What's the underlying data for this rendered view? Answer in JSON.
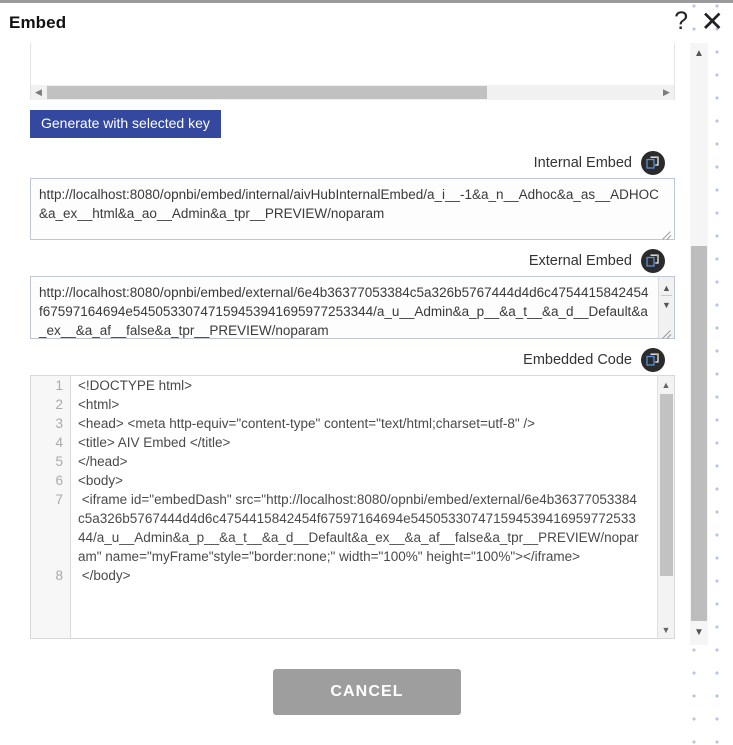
{
  "dialog": {
    "title": "Embed",
    "help_icon": "?",
    "close_icon": "✕"
  },
  "toolbar": {
    "generate_label": "Generate with selected key"
  },
  "internal_embed": {
    "label": "Internal Embed",
    "copy_icon": "copy-icon",
    "value": "http://localhost:8080/opnbi/embed/internal/aivHubInternalEmbed/a_i__-1&a_n__Adhoc&a_as__ADHOC&a_ex__html&a_ao__Admin&a_tpr__PREVIEW/noparam"
  },
  "external_embed": {
    "label": "External Embed",
    "copy_icon": "copy-icon",
    "value": "http://localhost:8080/opnbi/embed/external/6e4b36377053384c5a326b5767444d4d6c4754415842454f67597164694e54505330747159453941695977253344/a_u__Admin&a_p__&a_t__&a_d__Default&a_ex__&a_af__false&a_tpr__PREVIEW/noparam"
  },
  "embedded_code": {
    "label": "Embedded Code",
    "copy_icon": "copy-icon",
    "lines": [
      {
        "number": "1",
        "text": "<!DOCTYPE html>"
      },
      {
        "number": "2",
        "text": "<html>"
      },
      {
        "number": "3",
        "text": "<head> <meta http-equiv=\"content-type\" content=\"text/html;charset=utf-8\" />"
      },
      {
        "number": "4",
        "text": "<title> AIV Embed </title>"
      },
      {
        "number": "5",
        "text": "</head>"
      },
      {
        "number": "6",
        "text": "<body>"
      },
      {
        "number": "7",
        "text": " <iframe id=\"embedDash\" src=\"http://localhost:8080/opnbi/embed/external/6e4b36377053384c5a326b5767444d4d6c4754415842454f67597164694e54505330747159453941695977253344/a_u__Admin&a_p__&a_t__&a_d__Default&a_ex__&a_af__false&a_tpr__PREVIEW/noparam\" name=\"myFrame\"style=\"border:none;\" width=\"100%\" height=\"100%\"></iframe>"
      },
      {
        "number": "8",
        "text": " </body>"
      }
    ]
  },
  "footer": {
    "cancel_label": "CANCEL"
  },
  "scrollbars": {
    "left_arrow": "◀",
    "right_arrow": "▶",
    "up_arrow": "▲",
    "down_arrow": "▼"
  },
  "colors": {
    "accent_blue": "#33489e",
    "cancel_grey": "#9e9e9e",
    "dot_pattern": "#b9c3e8",
    "icon_dark": "#2b2b2b"
  }
}
